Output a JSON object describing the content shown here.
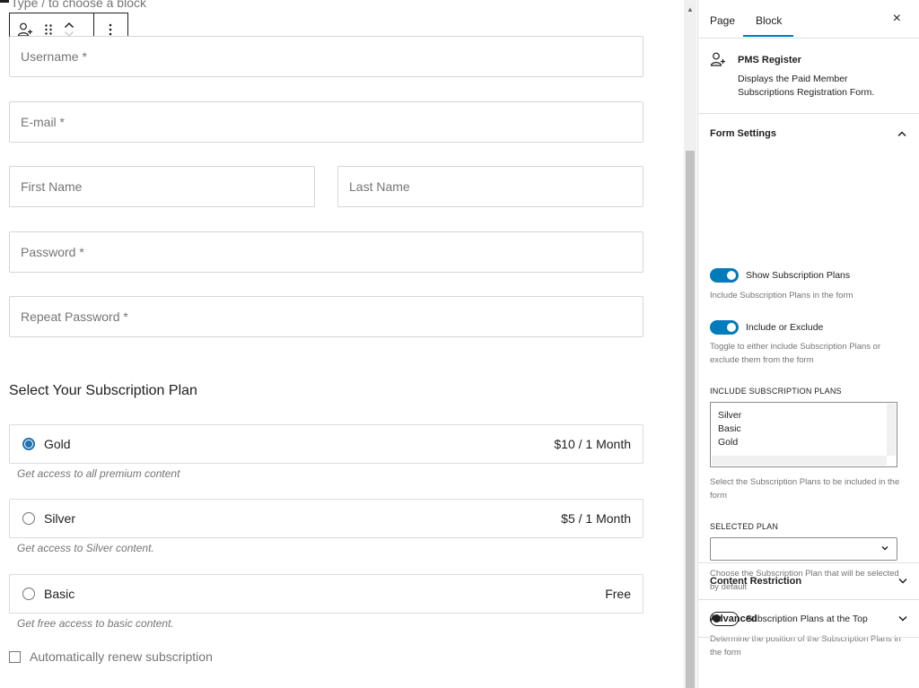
{
  "editor": {
    "block_placeholder": "Type / to choose a block",
    "toolbar": {
      "icons": [
        "user-add-icon",
        "drag-handle-icon",
        "chevron-up-icon",
        "chevron-down-icon",
        "more-vertical-icon"
      ]
    }
  },
  "form": {
    "username_placeholder": "Username *",
    "email_placeholder": "E-mail *",
    "first_name_placeholder": "First Name",
    "last_name_placeholder": "Last Name",
    "password_placeholder": "Password *",
    "repeat_password_placeholder": "Repeat Password *",
    "plans_title": "Select Your Subscription Plan",
    "plans": [
      {
        "name": "Gold",
        "price": "$10 / 1 Month",
        "description": "Get access to all premium content",
        "selected": true
      },
      {
        "name": "Silver",
        "price": "$5 / 1 Month",
        "description": "Get access to Silver content.",
        "selected": false
      },
      {
        "name": "Basic",
        "price": "Free",
        "description": "Get free access to basic content.",
        "selected": false
      }
    ],
    "auto_renew_label": "Automatically renew subscription"
  },
  "sidebar": {
    "tabs": [
      {
        "label": "Page",
        "active": false
      },
      {
        "label": "Block",
        "active": true
      }
    ],
    "close_symbol": "×",
    "block": {
      "name": "PMS Register",
      "description": "Displays the Paid Member Subscriptions Registration Form."
    },
    "form_settings": {
      "title": "Form Settings",
      "show_plans": {
        "label": "Show Subscription Plans",
        "help": "Include Subscription Plans in the form",
        "on": true
      },
      "include_exclude": {
        "label": "Include or Exclude",
        "help": "Toggle to either include Subscription Plans or exclude them from the form",
        "on": true
      },
      "include_plans": {
        "label": "INCLUDE SUBSCRIPTION PLANS",
        "options": [
          "Silver",
          "Basic",
          "Gold"
        ],
        "help": "Select the Subscription Plans to be included in the form"
      },
      "selected_plan": {
        "label": "SELECTED PLAN",
        "value": "",
        "help": "Choose the Subscription Plan that will be selected by default"
      },
      "plans_top": {
        "label": "Subscription Plans at the Top",
        "help": "Determine the position of the Subscription Plans in the form",
        "on": false
      }
    },
    "content_restriction": {
      "title": "Content Restriction"
    },
    "advanced": {
      "title": "Advanced"
    }
  },
  "colors": {
    "accent": "#007cba",
    "radio": "#2271b1"
  }
}
